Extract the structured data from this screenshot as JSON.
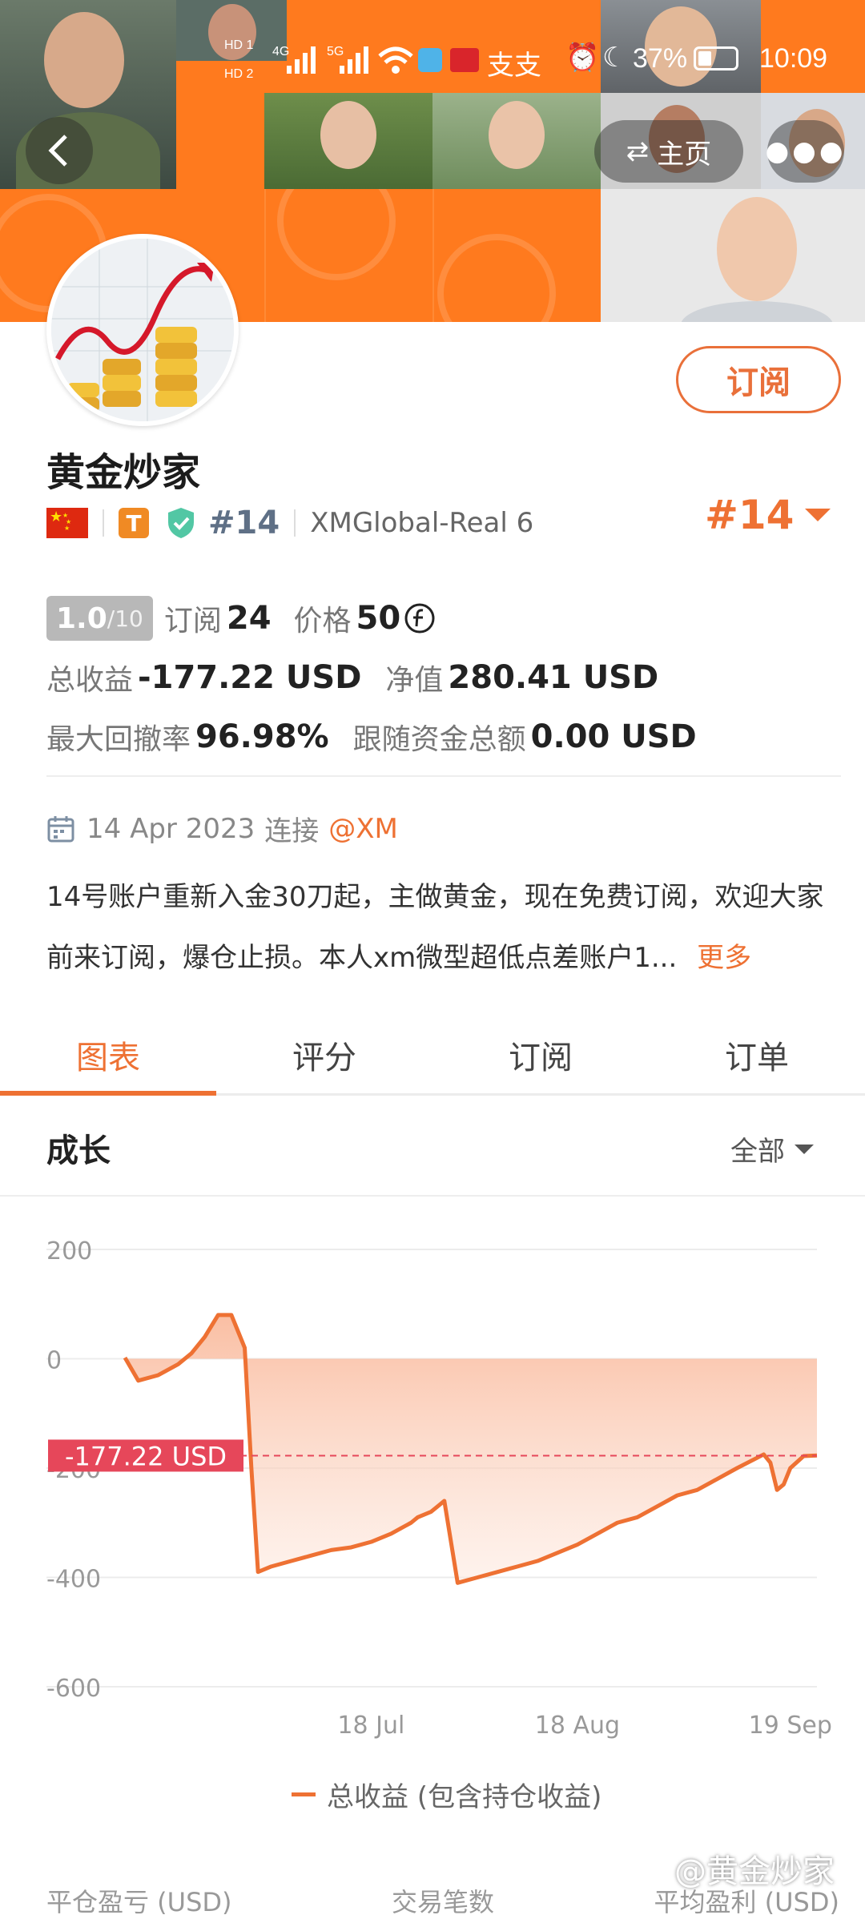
{
  "status_bar": {
    "hd1": "HD 1",
    "hd2": "HD 2",
    "net1": "4G",
    "net2": "5G",
    "battery_pct": "37%",
    "time": "10:09"
  },
  "header": {
    "home_label": "主页"
  },
  "profile": {
    "subscribe_label": "订阅",
    "name": "黄金炒家",
    "t_badge": "T",
    "rank_small": "#14",
    "account": "XMGlobal-Real 6",
    "rank_big": "#14"
  },
  "stats": {
    "score": "1.0",
    "score_max": "/10",
    "subscriptions_label": "订阅",
    "subscriptions_value": "24",
    "price_label": "价格",
    "price_value": "50",
    "total_profit_label": "总收益",
    "total_profit_value": "-177.22 USD",
    "equity_label": "净值",
    "equity_value": "280.41 USD",
    "max_dd_label": "最大回撤率",
    "max_dd_value": "96.98%",
    "follow_label": "跟随资金总额",
    "follow_value": "0.00 USD"
  },
  "connection": {
    "date": "14 Apr 2023",
    "connect_label": "连接",
    "broker": "@XM"
  },
  "description": {
    "text": "14号账户重新入金30刀起，主做黄金，现在免费订阅，欢迎大家前来订阅，爆仓止损。本人xm微型超低点差账户1...",
    "more": "更多"
  },
  "tabs": [
    "图表",
    "评分",
    "订阅",
    "订单"
  ],
  "section": {
    "title": "成长",
    "range": "全部"
  },
  "chart_data": {
    "type": "area",
    "title": "成长",
    "y_ticks": [
      "200",
      "0",
      "-200",
      "-400",
      "-600"
    ],
    "x_ticks": [
      "18 Jul",
      "18 Aug",
      "19 Sep"
    ],
    "ylim": [
      -600,
      200
    ],
    "current_label": "-177.22 USD",
    "current_value": -177.22,
    "series": [
      {
        "name": "总收益 (包含持仓收益)",
        "x": [
          "2023-06-11",
          "2023-06-13",
          "2023-06-16",
          "2023-06-19",
          "2023-06-21",
          "2023-06-23",
          "2023-06-25",
          "2023-06-26",
          "2023-06-27",
          "2023-06-28",
          "2023-06-29",
          "2023-06-30",
          "2023-07-01",
          "2023-07-03",
          "2023-07-06",
          "2023-07-09",
          "2023-07-12",
          "2023-07-15",
          "2023-07-18",
          "2023-07-21",
          "2023-07-24",
          "2023-07-25",
          "2023-07-27",
          "2023-07-28",
          "2023-07-29",
          "2023-07-31",
          "2023-08-03",
          "2023-08-06",
          "2023-08-09",
          "2023-08-12",
          "2023-08-15",
          "2023-08-18",
          "2023-08-21",
          "2023-08-24",
          "2023-08-27",
          "2023-08-30",
          "2023-09-02",
          "2023-09-05",
          "2023-09-08",
          "2023-09-11",
          "2023-09-15",
          "2023-09-16",
          "2023-09-17",
          "2023-09-18",
          "2023-09-19",
          "2023-09-21",
          "2023-09-23"
        ],
        "values": [
          2,
          -40,
          -30,
          -10,
          10,
          40,
          80,
          80,
          80,
          50,
          20,
          -200,
          -390,
          -380,
          -370,
          -360,
          -350,
          -345,
          -335,
          -320,
          -300,
          -290,
          -280,
          -270,
          -260,
          -410,
          -400,
          -390,
          -380,
          -370,
          -355,
          -340,
          -320,
          -300,
          -290,
          -270,
          -250,
          -240,
          -220,
          -200,
          -175,
          -190,
          -240,
          -230,
          -200,
          -178,
          -177
        ]
      }
    ]
  },
  "legend": {
    "label": "总收益 (包含持仓收益)"
  },
  "watermark": "@黄金炒家",
  "bottom_headers": [
    "平仓盈亏 (USD)",
    "交易笔数",
    "平均盈利 (USD)"
  ],
  "colors": {
    "accent": "#ee7133",
    "banner_orange": "#ff7a1e",
    "current_label_bg": "#e6475a"
  }
}
